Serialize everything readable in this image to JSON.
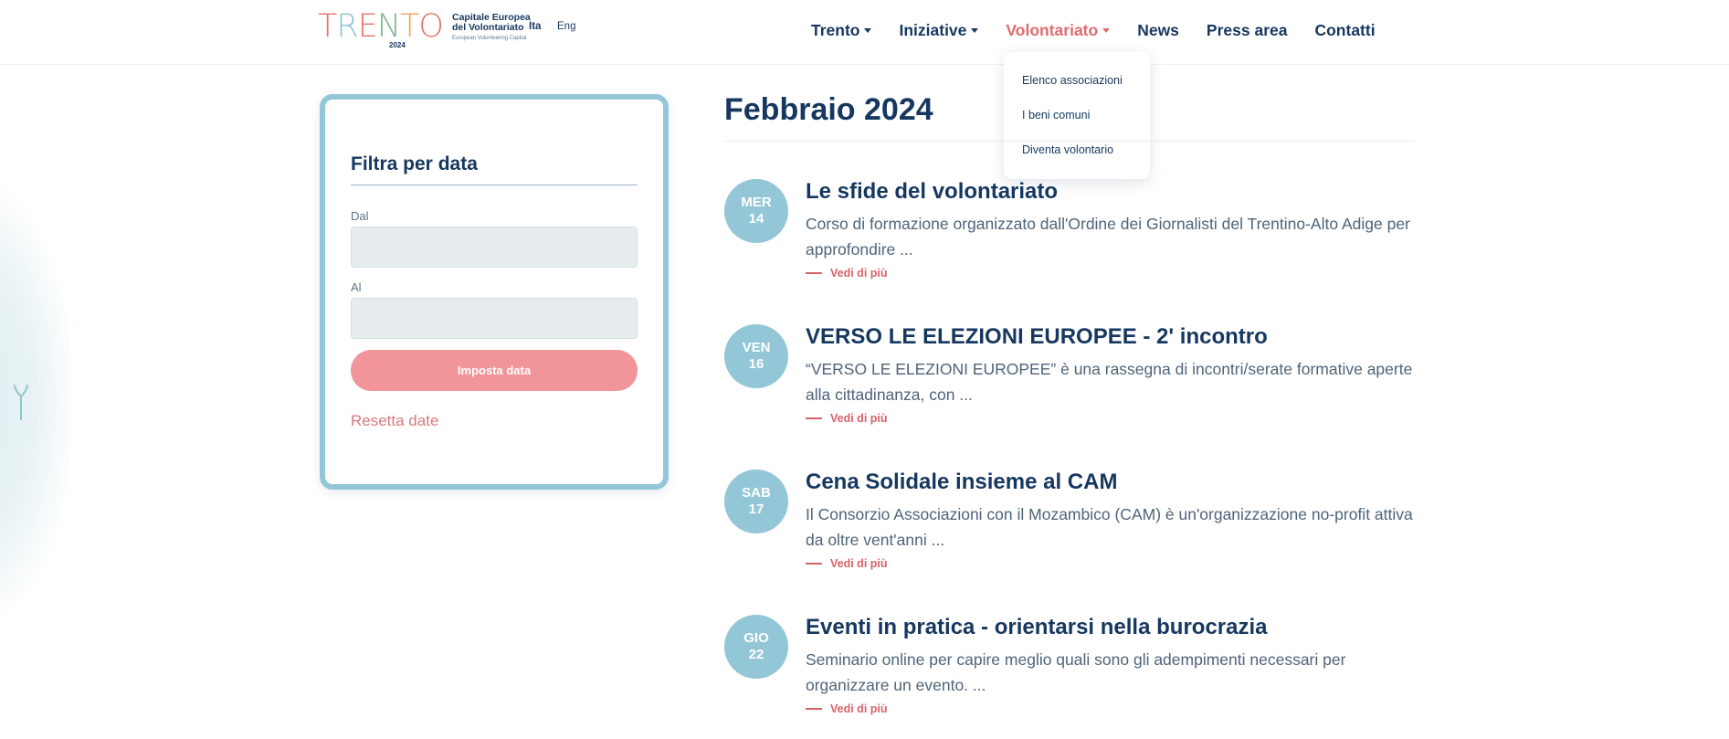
{
  "header": {
    "logo": {
      "word": "TRENTO",
      "year": "2024",
      "line1": "Capitale Europea",
      "line2": "del Volontariato",
      "line3": "European Volunteering Capital",
      "letter_colors": [
        "#e5736e",
        "#8fc3cf",
        "#e5736e",
        "#7fb58f",
        "#f0a35c",
        "#e5736e"
      ]
    },
    "languages": [
      "Ita",
      "Eng"
    ],
    "nav": [
      {
        "label": "Trento",
        "dropdown": true
      },
      {
        "label": "Iniziative",
        "dropdown": true
      },
      {
        "label": "Volontariato",
        "dropdown": true,
        "active": true
      },
      {
        "label": "News",
        "dropdown": false
      },
      {
        "label": "Press area",
        "dropdown": false
      },
      {
        "label": "Contatti",
        "dropdown": false
      }
    ],
    "dropdown_items": [
      "Elenco associazioni",
      "I beni comuni",
      "Diventa volontario"
    ]
  },
  "filter": {
    "title": "Filtra per data",
    "from_label": "Dal",
    "to_label": "Al",
    "from_value": "",
    "to_value": "",
    "submit_label": "Imposta data",
    "reset_label": "Resetta date"
  },
  "main": {
    "month": "Febbraio 2024",
    "more_label": "Vedi di più",
    "events": [
      {
        "day": "MER",
        "num": "14",
        "title": "Le sfide del volontariato",
        "desc": "Corso di formazione organizzato dall'Ordine dei Giornalisti del Trentino-Alto Adige per approfondire ..."
      },
      {
        "day": "VEN",
        "num": "16",
        "title": "VERSO LE ELEZIONI EUROPEE - 2' incontro",
        "desc": "“VERSO LE ELEZIONI EUROPEE” è una rassegna di incontri/serate formative aperte alla cittadinanza, con ..."
      },
      {
        "day": "SAB",
        "num": "17",
        "title": "Cena Solidale insieme al CAM",
        "desc": "Il Consorzio Associazioni con il Mozambico (CAM) è un'organizzazione no-profit attiva da oltre vent'anni ..."
      },
      {
        "day": "GIO",
        "num": "22",
        "title": "Eventi in pratica - orientarsi nella burocrazia",
        "desc": " Seminario online per capire meglio quali sono gli adempimenti necessari per organizzare un evento.  ..."
      }
    ]
  },
  "colors": {
    "navy": "#16375f",
    "accent": "#e06b6f",
    "badge": "#93c7d8",
    "button": "#f1959a"
  }
}
